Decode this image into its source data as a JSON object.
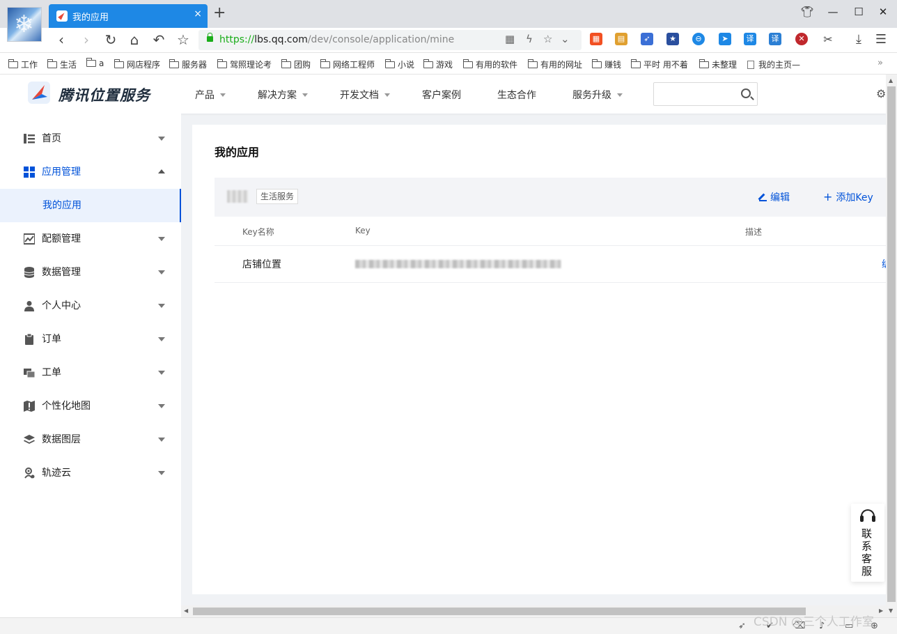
{
  "browser": {
    "tab_title": "我的应用",
    "tab_close": "×",
    "new_tab": "+",
    "url_scheme": "https://",
    "url_host": "lbs.qq.com",
    "url_path": "/dev/console/application/mine",
    "bookmarks": [
      "工作",
      "生活",
      "a",
      "网店程序",
      "服务器",
      "驾照理论考",
      "团购",
      "网络工程师",
      "小说",
      "游戏",
      "有用的软件",
      "有用的网址",
      "赚钱",
      "平时 用不着",
      "未整理"
    ],
    "bookmark_page": "我的主页—",
    "bookmark_more": "»",
    "extensions": [
      {
        "icon": "windows-grid-icon",
        "color": "#f25022"
      },
      {
        "icon": "news-icon",
        "color": "#e0a030"
      },
      {
        "icon": "rocket-icon",
        "color": "#3b6fd6"
      },
      {
        "icon": "star-badge-icon",
        "color": "#2a4f9e"
      },
      {
        "icon": "minus-circle-icon",
        "color": "#1e88e5"
      },
      {
        "icon": "arrow-badge-icon",
        "color": "#1e88e5"
      },
      {
        "icon": "translate-icon",
        "label": "译",
        "color": "#1e88e5"
      },
      {
        "icon": "calendar-translate-icon",
        "label": "译",
        "color": "#2b7fd4"
      },
      {
        "icon": "stop-x-icon",
        "color": "#c0282d"
      }
    ]
  },
  "site": {
    "logo_text": "腾讯位置服务",
    "nav": [
      {
        "label": "产品",
        "dropdown": true
      },
      {
        "label": "解决方案",
        "dropdown": true
      },
      {
        "label": "开发文档",
        "dropdown": true
      },
      {
        "label": "客户案例",
        "dropdown": false
      },
      {
        "label": "生态合作",
        "dropdown": false
      },
      {
        "label": "服务升级",
        "dropdown": true
      }
    ],
    "search_value": "",
    "accent_color": "#0052d9"
  },
  "sidebar": {
    "items": [
      {
        "label": "首页",
        "icon": "list-icon"
      },
      {
        "label": "应用管理",
        "icon": "grid-icon",
        "open": true
      },
      {
        "label": "配额管理",
        "icon": "chart-icon"
      },
      {
        "label": "数据管理",
        "icon": "database-icon"
      },
      {
        "label": "个人中心",
        "icon": "user-icon"
      },
      {
        "label": "订单",
        "icon": "clipboard-icon"
      },
      {
        "label": "工单",
        "icon": "ticket-icon"
      },
      {
        "label": "个性化地图",
        "icon": "map-warning-icon"
      },
      {
        "label": "数据图层",
        "icon": "layers-icon"
      },
      {
        "label": "轨迹云",
        "icon": "location-user-icon"
      }
    ],
    "active_sub": "我的应用"
  },
  "content": {
    "title": "我的应用",
    "app_tag": "生活服务",
    "edit_label": "编辑",
    "add_key_label": "添加Key",
    "table": {
      "headers": [
        "Key名称",
        "Key",
        "描述"
      ],
      "rows": [
        {
          "name": "店铺位置",
          "key": "",
          "desc": ""
        }
      ],
      "row_action_glyph": "编"
    }
  },
  "support_label": "联系客服",
  "watermark": "CSDN @三个人工作室"
}
